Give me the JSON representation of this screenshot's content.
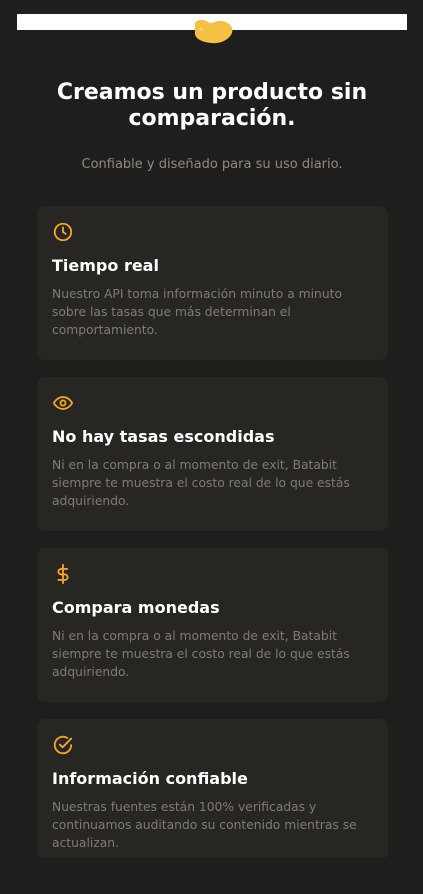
{
  "colors": {
    "accent": "#f3a42c",
    "background": "#1f1e1c",
    "card": "#282623",
    "title": "#ffffff",
    "muted": "#7f7b76"
  },
  "header": {
    "logo_icon": "yellow-blob-logo"
  },
  "hero": {
    "title": "Creamos un producto sin comparación.",
    "subtitle": "Confiable y diseñado para su uso diario."
  },
  "features": [
    {
      "icon": "clock-icon",
      "title": "Tiempo real",
      "description": "Nuestro API toma información minuto a minuto sobre las tasas que más determinan el comportamiento."
    },
    {
      "icon": "eye-icon",
      "title": "No hay tasas escondidas",
      "description": "Ni en la compra o al momento de exit, Batabit siempre te muestra el costo real de lo que estás adquiriendo."
    },
    {
      "icon": "dollar-icon",
      "title": "Compara monedas",
      "description": "Ni en la compra o al momento de exit, Batabit siempre te muestra el costo real de lo que estás adquiriendo."
    },
    {
      "icon": "check-circle-icon",
      "title": "Información confiable",
      "description": "Nuestras fuentes están 100% verificadas y continuamos auditando su contenido mientras se actualizan."
    }
  ]
}
